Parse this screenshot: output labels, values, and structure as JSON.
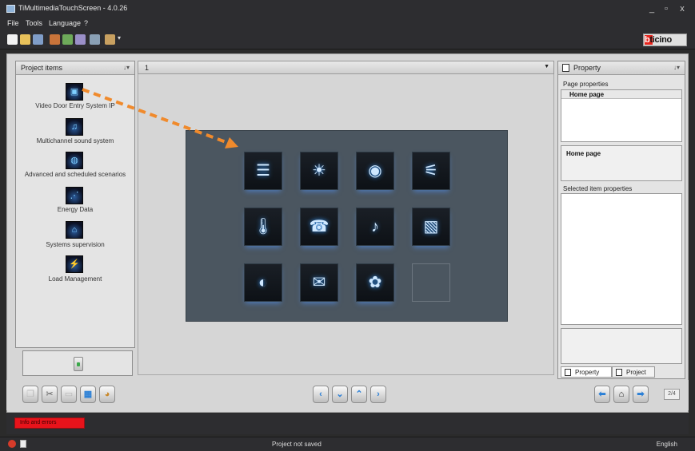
{
  "window": {
    "title": "TiMultimediaTouchScreen - 4.0.26",
    "minimize_glyph": "_",
    "maximize_glyph": "▫",
    "close_glyph": "x"
  },
  "menu": [
    "File",
    "Tools",
    "Language",
    "?"
  ],
  "brand": {
    "first": "b",
    "rest": "ticino"
  },
  "left_panel": {
    "title": "Project items",
    "pin": "↓▾",
    "items": [
      {
        "label": "Video Door Entry System IP",
        "icon": "video-door-entry-icon",
        "glyph": "▣"
      },
      {
        "label": "Multichannel sound system",
        "icon": "music-note-icon",
        "glyph": "♫"
      },
      {
        "label": "Advanced and scheduled scenarios",
        "icon": "scenario-icon",
        "glyph": "◍"
      },
      {
        "label": "Energy Data",
        "icon": "energy-data-icon",
        "glyph": "⋰"
      },
      {
        "label": "Systems supervision",
        "icon": "house-search-icon",
        "glyph": "⌂"
      },
      {
        "label": "Load Management",
        "icon": "load-management-icon",
        "glyph": "⚡"
      }
    ]
  },
  "center": {
    "page_number": "1",
    "dropdown_glyph": "▼"
  },
  "tiles": [
    {
      "icon": "shutter-icon",
      "glyph": "☰"
    },
    {
      "icon": "lightbulb-icon",
      "glyph": "☀"
    },
    {
      "icon": "alarm-signal-icon",
      "glyph": "◉"
    },
    {
      "icon": "plug-icon",
      "glyph": "⚟"
    },
    {
      "icon": "thermometer-icon",
      "glyph": "🌡"
    },
    {
      "icon": "video-door-entry-icon",
      "glyph": "☎"
    },
    {
      "icon": "music-icon",
      "glyph": "♪"
    },
    {
      "icon": "photo-frame-icon",
      "glyph": "▧"
    },
    {
      "icon": "scenario-icon",
      "glyph": "◐"
    },
    {
      "icon": "message-envelope-icon",
      "glyph": "✉"
    },
    {
      "icon": "flower-house-icon",
      "glyph": "✿"
    },
    {
      "icon": "empty-slot",
      "glyph": ""
    }
  ],
  "right_panel": {
    "title": "Property",
    "pin": "↓▾",
    "page_properties_label": "Page properties",
    "page_properties_value": "Home page",
    "page_name": "Home page",
    "selected_item_label": "Selected item properties",
    "tabs": [
      "Property",
      "Project"
    ]
  },
  "bottom_bar": {
    "left_tools": [
      {
        "icon": "copy-icon",
        "glyph": "❐",
        "state": "disabled"
      },
      {
        "icon": "cut-icon",
        "glyph": "✂",
        "state": "enabled"
      },
      {
        "icon": "paste-icon",
        "glyph": "▭",
        "state": "disabled"
      },
      {
        "icon": "grid-table-icon",
        "glyph": "▦",
        "state": "enabled"
      },
      {
        "icon": "palette-icon",
        "glyph": "◕",
        "state": "enabled"
      }
    ],
    "nav": [
      {
        "icon": "chevron-left-icon",
        "glyph": "‹"
      },
      {
        "icon": "chevron-down-icon",
        "glyph": "⌄"
      },
      {
        "icon": "chevron-up-icon",
        "glyph": "⌃"
      },
      {
        "icon": "chevron-right-icon",
        "glyph": "›"
      }
    ],
    "page_nav": [
      {
        "icon": "arrow-left-icon",
        "glyph": "⬅"
      },
      {
        "icon": "home-icon",
        "glyph": "⌂"
      },
      {
        "icon": "arrow-right-icon",
        "glyph": "➡"
      }
    ],
    "page_counter": "2/4"
  },
  "info_tab": "Info and errors",
  "status": {
    "text": "Project not saved",
    "language": "English"
  },
  "colors": {
    "accent_blue": "#2a7fd6",
    "error_red": "#e8131b",
    "drag_arrow": "#f08a2c"
  }
}
